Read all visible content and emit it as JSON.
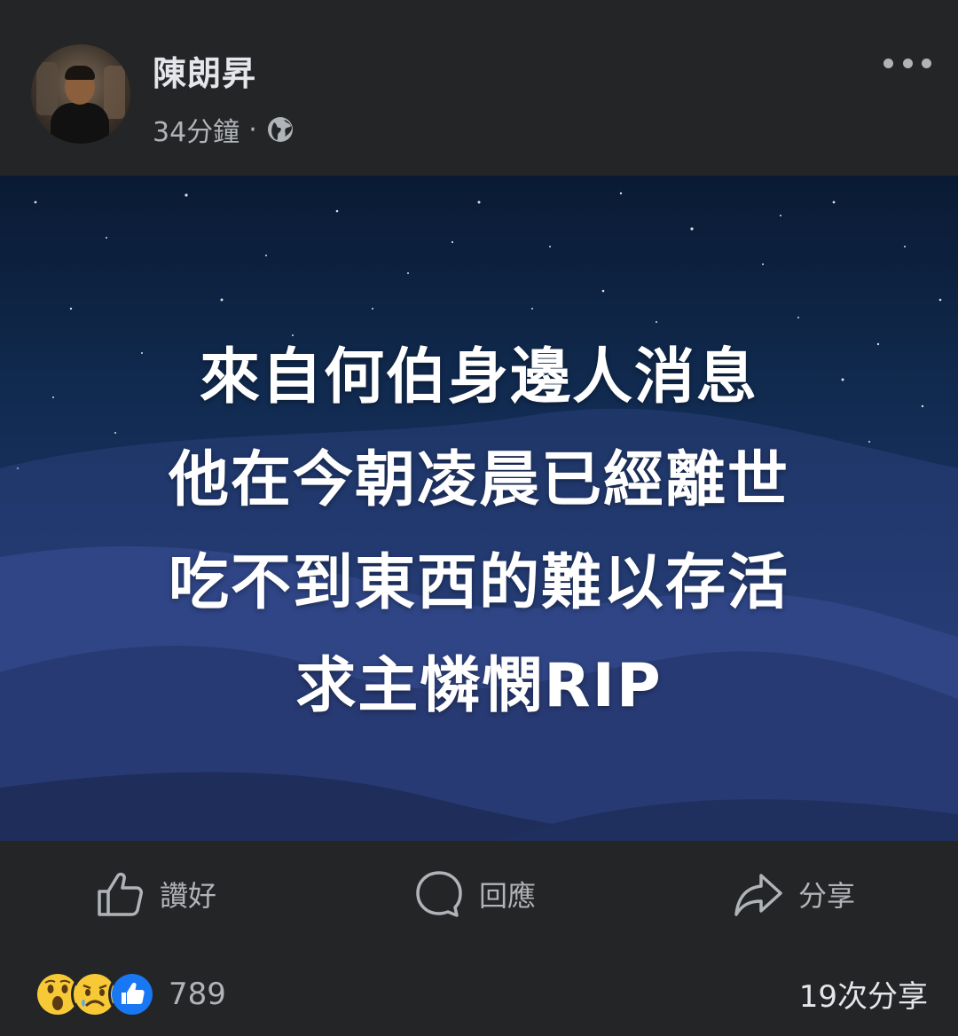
{
  "post": {
    "author": "陳朗昇",
    "time": "34分鐘",
    "separator": "·",
    "privacy_icon": "globe-icon",
    "image_text": [
      "來自何伯身邊人消息",
      "他在今朝凌晨已經離世",
      "吃不到東西的難以存活",
      "求主憐憫RIP"
    ]
  },
  "actions": {
    "like_label": "讚好",
    "comment_label": "回應",
    "share_label": "分享"
  },
  "footer": {
    "reaction_icons": [
      "wow-icon",
      "sad-icon",
      "like-icon"
    ],
    "reaction_count": "789",
    "share_count": "19次分享"
  },
  "colors": {
    "background": "#242526",
    "text_primary": "#e4e6eb",
    "text_secondary": "#b0b3b8",
    "like_blue": "#1877f2"
  }
}
